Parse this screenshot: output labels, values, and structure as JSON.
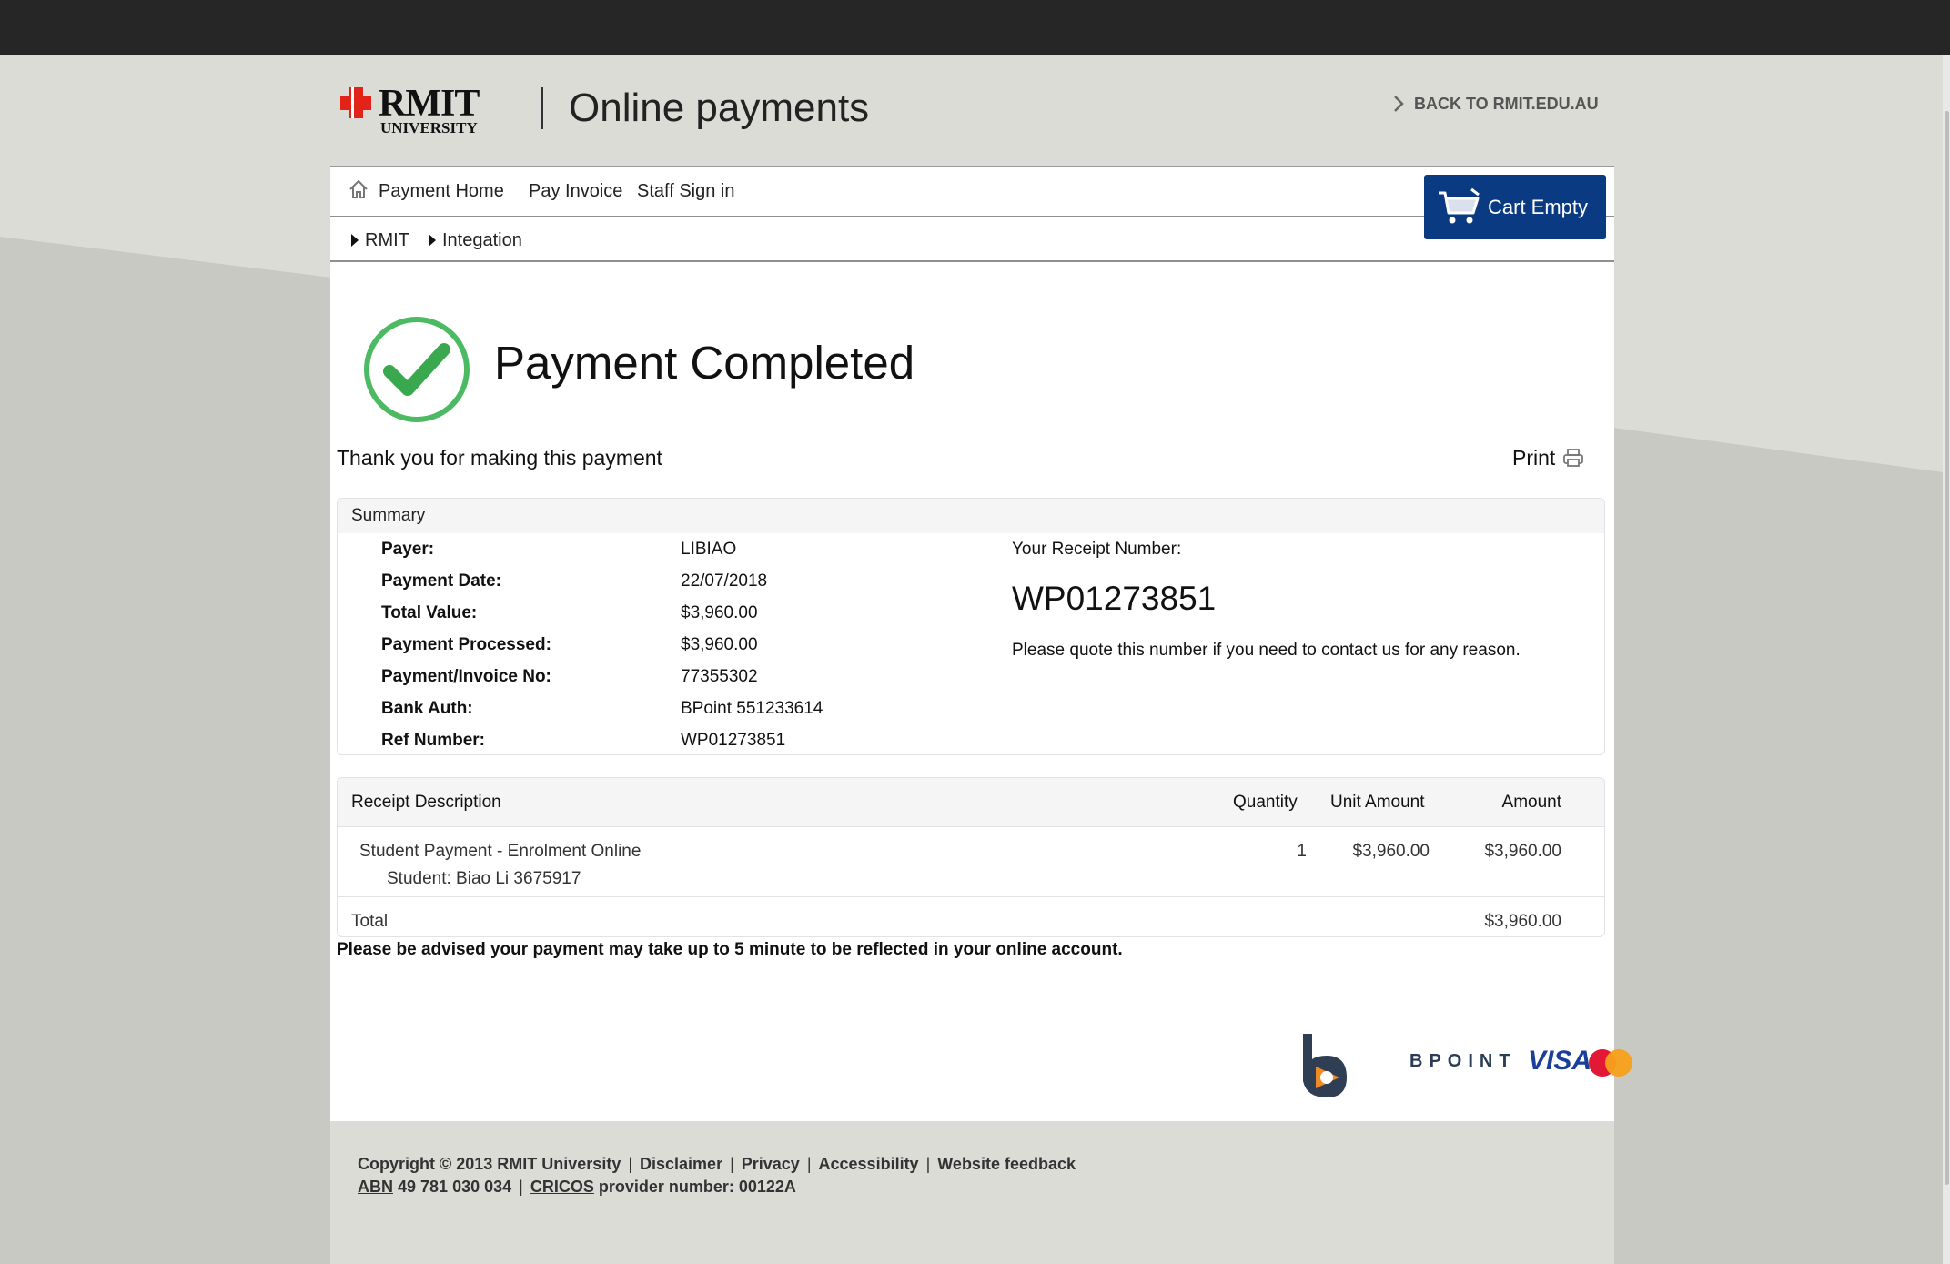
{
  "header": {
    "logo_word": "RMIT",
    "logo_sub": "UNIVERSITY",
    "site_title": "Online payments",
    "back_link": "BACK TO RMIT.EDU.AU"
  },
  "nav": {
    "items": [
      {
        "label": "Payment Home"
      },
      {
        "label": "Pay Invoice"
      },
      {
        "label": "Staff Sign in"
      }
    ],
    "breadcrumbs": [
      {
        "label": "RMIT"
      },
      {
        "label": "Integation"
      }
    ],
    "cart_label": "Cart Empty"
  },
  "status": {
    "title": "Payment Completed",
    "thank_you": "Thank you for making this payment",
    "print_label": "Print"
  },
  "summary": {
    "title": "Summary",
    "rows": [
      {
        "label": "Payer:",
        "value": "LIBIAO"
      },
      {
        "label": "Payment Date:",
        "value": "22/07/2018"
      },
      {
        "label": "Total Value:",
        "value": "$3,960.00"
      },
      {
        "label": "Payment Processed:",
        "value": "$3,960.00"
      },
      {
        "label": "Payment/Invoice No:",
        "value": "77355302"
      },
      {
        "label": "Bank Auth:",
        "value": "BPoint 551233614"
      },
      {
        "label": "Ref Number:",
        "value": "WP01273851"
      }
    ],
    "receipt_label": "Your Receipt Number:",
    "receipt_number": "WP01273851",
    "receipt_note": "Please quote this number if you need to contact us for any reason."
  },
  "receipt": {
    "headers": {
      "description": "Receipt Description",
      "quantity": "Quantity",
      "unit_amount": "Unit Amount",
      "amount": "Amount"
    },
    "items": [
      {
        "description": "Student Payment - Enrolment Online",
        "detail": "Student: Biao Li 3675917",
        "quantity": "1",
        "unit_amount": "$3,960.00",
        "amount": "$3,960.00"
      }
    ],
    "total_label": "Total",
    "total_amount": "$3,960.00"
  },
  "advisory": "Please be advised your payment may take up to 5 minute to be reflected in your online account.",
  "payment_logos": {
    "bpoint": "BPOINT",
    "visa": "VISA",
    "mastercard": "MasterCard"
  },
  "footer": {
    "copyright": "Copyright © 2013 RMIT University",
    "links": [
      "Disclaimer",
      "Privacy",
      "Accessibility",
      "Website feedback"
    ],
    "abn_label": "ABN",
    "abn_value": "49 781 030 034",
    "cricos_label": "CRICOS",
    "cricos_value": "provider number: 00122A"
  },
  "colors": {
    "topbar": "#262626",
    "cart_button": "#0a3a82",
    "check_green": "#4cba62",
    "logo_red": "#e2231a"
  }
}
